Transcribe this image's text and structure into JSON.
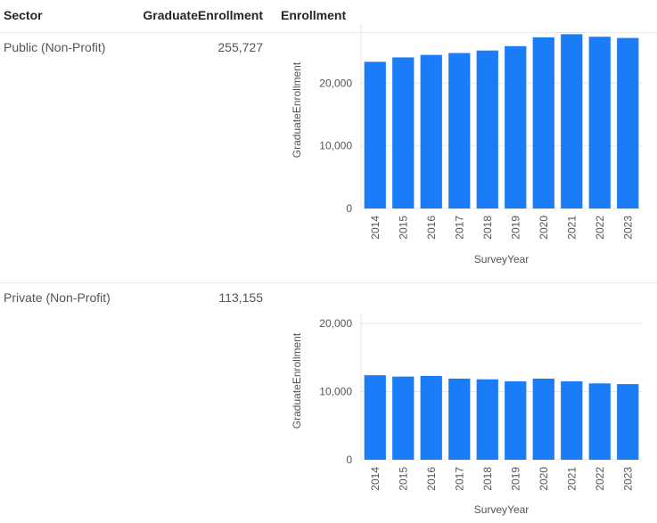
{
  "table": {
    "columns": [
      "Sector",
      "GraduateEnrollment",
      "Enrollment"
    ],
    "rows": [
      {
        "sector": "Public (Non-Profit)",
        "graduate_enrollment": "255,727"
      },
      {
        "sector": "Private (Non-Profit)",
        "graduate_enrollment": "113,155"
      }
    ]
  },
  "chart_data": [
    {
      "type": "bar",
      "categories": [
        "2014",
        "2015",
        "2016",
        "2017",
        "2018",
        "2019",
        "2020",
        "2021",
        "2022",
        "2023"
      ],
      "values": [
        23400,
        24100,
        24500,
        24800,
        25200,
        25900,
        27300,
        27800,
        27400,
        27200
      ],
      "xlabel": "SurveyYear",
      "ylabel": "GraduateEnrollment",
      "ylim": [
        0,
        28000
      ],
      "yticks": [
        0,
        10000,
        20000
      ],
      "ytick_labels": [
        "0",
        "10,000",
        "20,000"
      ],
      "grid": true,
      "color": "#1a7cf6"
    },
    {
      "type": "bar",
      "categories": [
        "2014",
        "2015",
        "2016",
        "2017",
        "2018",
        "2019",
        "2020",
        "2021",
        "2022",
        "2023"
      ],
      "values": [
        12400,
        12200,
        12300,
        11900,
        11800,
        11500,
        11900,
        11500,
        11200,
        11100
      ],
      "xlabel": "SurveyYear",
      "ylabel": "GraduateEnrollment",
      "ylim": [
        0,
        20000
      ],
      "yticks": [
        0,
        10000,
        20000
      ],
      "ytick_labels": [
        "0",
        "10,000",
        "20,000"
      ],
      "grid": true,
      "color": "#1a7cf6"
    }
  ]
}
